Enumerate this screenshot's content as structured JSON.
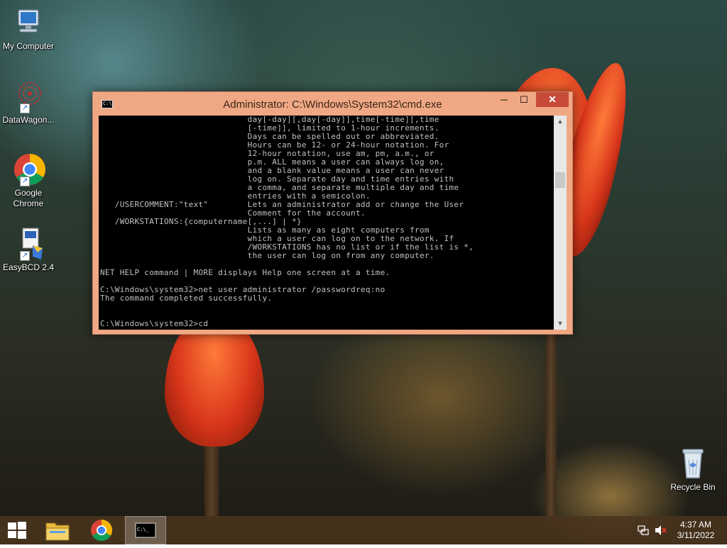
{
  "desktop": {
    "icons": [
      {
        "label": "My Computer"
      },
      {
        "label": "DataWagon..."
      },
      {
        "label": "Google Chrome"
      },
      {
        "label": "EasyBCD 2.4"
      },
      {
        "label": "Recycle Bin"
      }
    ]
  },
  "window": {
    "title": "Administrator: C:\\Windows\\System32\\cmd.exe",
    "minimize_symbol": "─",
    "maximize_symbol": "☐",
    "close_symbol": "✕",
    "console_lines": [
      "                              day[-day][,day[-day]],time[-time][,time",
      "                              [-time]], limited to 1-hour increments.",
      "                              Days can be spelled out or abbreviated.",
      "                              Hours can be 12- or 24-hour notation. For",
      "                              12-hour notation, use am, pm, a.m., or",
      "                              p.m. ALL means a user can always log on,",
      "                              and a blank value means a user can never",
      "                              log on. Separate day and time entries with",
      "                              a comma, and separate multiple day and time",
      "                              entries with a semicolon.",
      "   /USERCOMMENT:\"text\"        Lets an administrator add or change the User",
      "                              Comment for the account.",
      "   /WORKSTATIONS:{computername[,...] | *}",
      "                              Lists as many as eight computers from",
      "                              which a user can log on to the network. If",
      "                              /WORKSTATIONS has no list or if the list is *,",
      "                              the user can log on from any computer.",
      "",
      "NET HELP command | MORE displays Help one screen at a time.",
      "",
      "C:\\Windows\\system32>net user administrator /passwordreq:no",
      "The command completed successfully.",
      "",
      "",
      "C:\\Windows\\system32>cd"
    ]
  },
  "taskbar": {
    "clock_time": "4:37 AM",
    "clock_date": "3/11/2022"
  },
  "colors": {
    "titlebar": "#f0a884",
    "close_button": "#c74b3b",
    "console_bg": "#000000",
    "console_fg": "#c0c0c0",
    "taskbar": "#4a341e"
  }
}
